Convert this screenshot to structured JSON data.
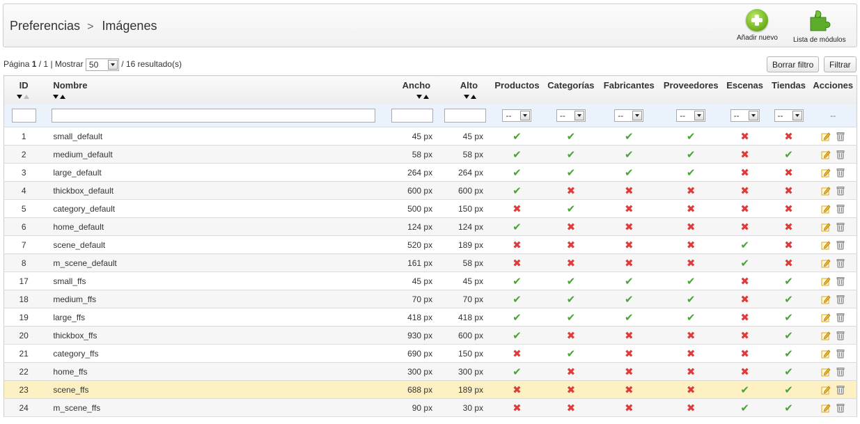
{
  "breadcrumb": {
    "parent": "Preferencias",
    "separator": ">",
    "current": "Imágenes"
  },
  "toolbar": {
    "add_label": "Añadir nuevo",
    "modules_label": "Lista de módulos"
  },
  "pagination": {
    "page_word": "Página",
    "page": "1",
    "of_pages": "/ 1",
    "show_word": "| Mostrar",
    "per_page": "50",
    "results": "/ 16 resultado(s)"
  },
  "actions": {
    "reset_filter": "Borrar filtro",
    "filter": "Filtrar"
  },
  "columns": {
    "id": "ID",
    "name": "Nombre",
    "width": "Ancho",
    "height": "Alto",
    "products": "Productos",
    "categories": "Categorías",
    "manufacturers": "Fabricantes",
    "suppliers": "Proveedores",
    "scenes": "Escenas",
    "stores": "Tiendas",
    "actions": "Acciones"
  },
  "filters": {
    "select_value": "--",
    "actions_placeholder": "--"
  },
  "colors": {
    "check": "#4ba23a",
    "cross": "#e03b3b",
    "highlight_row": "#fdf1c3"
  },
  "rows": [
    {
      "id": "1",
      "name": "small_default",
      "width": "45 px",
      "height": "45 px",
      "flags": [
        true,
        true,
        true,
        true,
        false,
        false
      ]
    },
    {
      "id": "2",
      "name": "medium_default",
      "width": "58 px",
      "height": "58 px",
      "flags": [
        true,
        true,
        true,
        true,
        false,
        true
      ]
    },
    {
      "id": "3",
      "name": "large_default",
      "width": "264 px",
      "height": "264 px",
      "flags": [
        true,
        true,
        true,
        true,
        false,
        false
      ]
    },
    {
      "id": "4",
      "name": "thickbox_default",
      "width": "600 px",
      "height": "600 px",
      "flags": [
        true,
        false,
        false,
        false,
        false,
        false
      ]
    },
    {
      "id": "5",
      "name": "category_default",
      "width": "500 px",
      "height": "150 px",
      "flags": [
        false,
        true,
        false,
        false,
        false,
        false
      ]
    },
    {
      "id": "6",
      "name": "home_default",
      "width": "124 px",
      "height": "124 px",
      "flags": [
        true,
        false,
        false,
        false,
        false,
        false
      ]
    },
    {
      "id": "7",
      "name": "scene_default",
      "width": "520 px",
      "height": "189 px",
      "flags": [
        false,
        false,
        false,
        false,
        true,
        false
      ]
    },
    {
      "id": "8",
      "name": "m_scene_default",
      "width": "161 px",
      "height": "58 px",
      "flags": [
        false,
        false,
        false,
        false,
        true,
        false
      ]
    },
    {
      "id": "17",
      "name": "small_ffs",
      "width": "45 px",
      "height": "45 px",
      "flags": [
        true,
        true,
        true,
        true,
        false,
        true
      ]
    },
    {
      "id": "18",
      "name": "medium_ffs",
      "width": "70 px",
      "height": "70 px",
      "flags": [
        true,
        true,
        true,
        true,
        false,
        true
      ]
    },
    {
      "id": "19",
      "name": "large_ffs",
      "width": "418 px",
      "height": "418 px",
      "flags": [
        true,
        true,
        true,
        true,
        false,
        true
      ]
    },
    {
      "id": "20",
      "name": "thickbox_ffs",
      "width": "930 px",
      "height": "600 px",
      "flags": [
        true,
        false,
        false,
        false,
        false,
        true
      ]
    },
    {
      "id": "21",
      "name": "category_ffs",
      "width": "690 px",
      "height": "150 px",
      "flags": [
        false,
        true,
        false,
        false,
        false,
        true
      ]
    },
    {
      "id": "22",
      "name": "home_ffs",
      "width": "300 px",
      "height": "300 px",
      "flags": [
        true,
        false,
        false,
        false,
        false,
        true
      ]
    },
    {
      "id": "23",
      "name": "scene_ffs",
      "width": "688 px",
      "height": "189 px",
      "flags": [
        false,
        false,
        false,
        false,
        true,
        true
      ],
      "highlighted": true
    },
    {
      "id": "24",
      "name": "m_scene_ffs",
      "width": "90 px",
      "height": "30 px",
      "flags": [
        false,
        false,
        false,
        false,
        true,
        true
      ]
    }
  ]
}
